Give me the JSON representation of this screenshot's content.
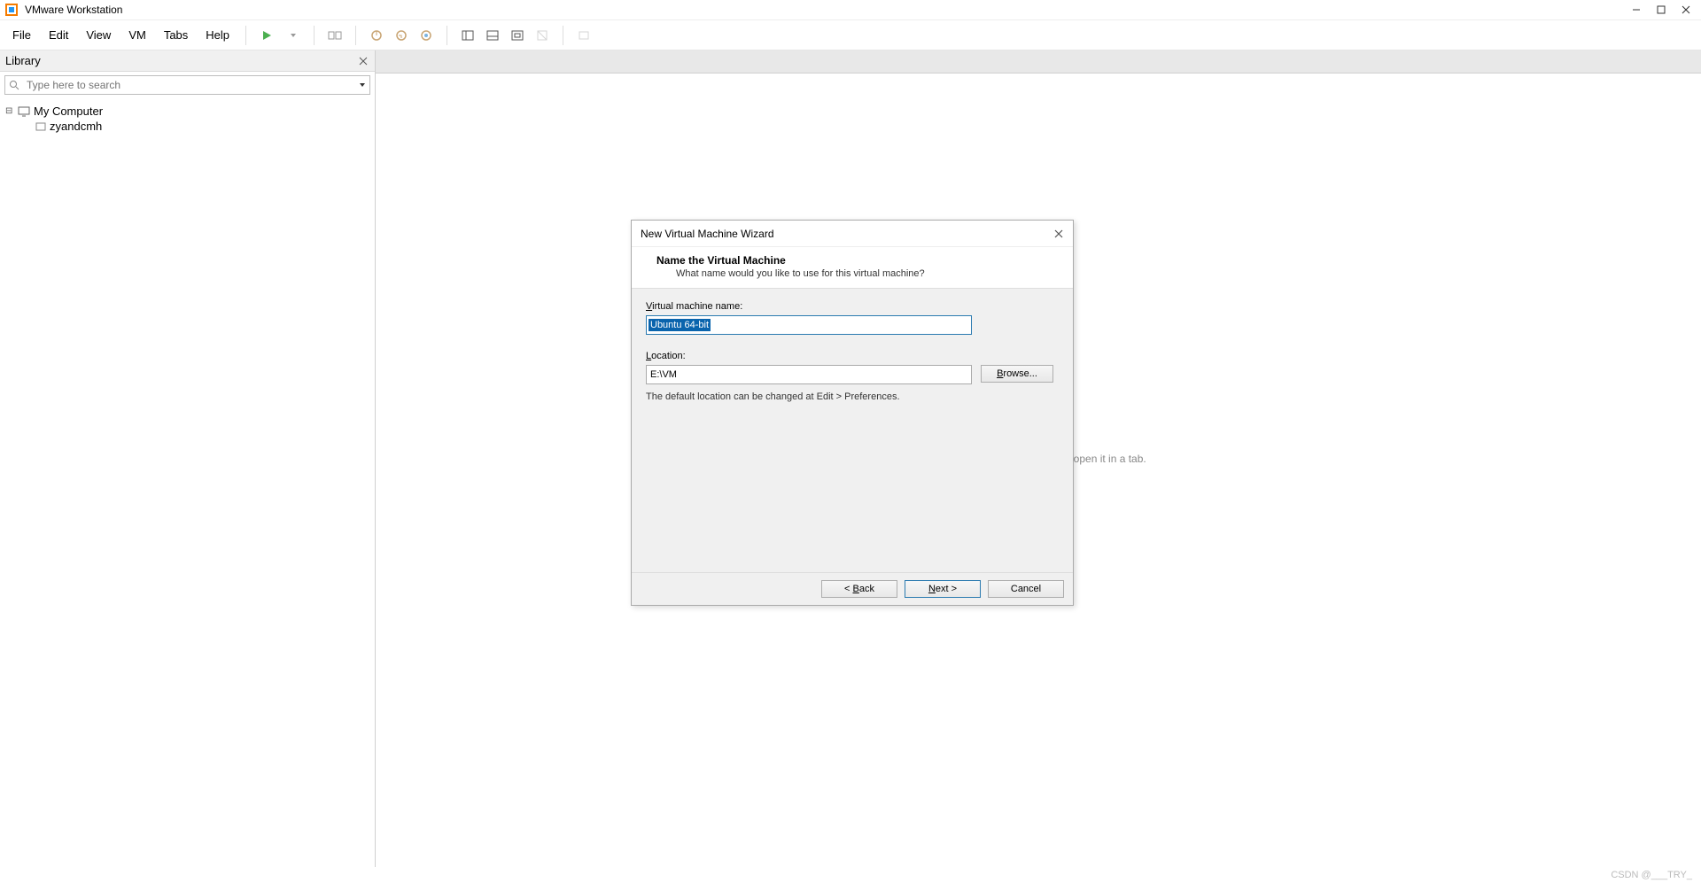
{
  "app": {
    "title": "VMware Workstation"
  },
  "menu": {
    "file": "File",
    "edit": "Edit",
    "view": "View",
    "vm": "VM",
    "tabs": "Tabs",
    "help": "Help"
  },
  "library": {
    "title": "Library",
    "search_placeholder": "Type here to search",
    "root": "My Computer",
    "vm": "zyandcmh"
  },
  "content": {
    "hint": "Select an item in the library to open it in a tab."
  },
  "dialog": {
    "title": "New Virtual Machine Wizard",
    "heading": "Name the Virtual Machine",
    "subheading": "What name would you like to use for this virtual machine?",
    "name_label_pre": "V",
    "name_label_rest": "irtual machine name:",
    "name_value": "Ubuntu 64-bit",
    "loc_label_pre": "L",
    "loc_label_rest": "ocation:",
    "loc_value": "E:\\VM",
    "browse_pre": "B",
    "browse_rest": "rowse...",
    "note": "The default location can be changed at Edit > Preferences.",
    "back_pre": "< ",
    "back_ul": "B",
    "back_rest": "ack",
    "next_ul": "N",
    "next_rest": "ext >",
    "cancel": "Cancel"
  },
  "footer": "CSDN @___TRY_"
}
